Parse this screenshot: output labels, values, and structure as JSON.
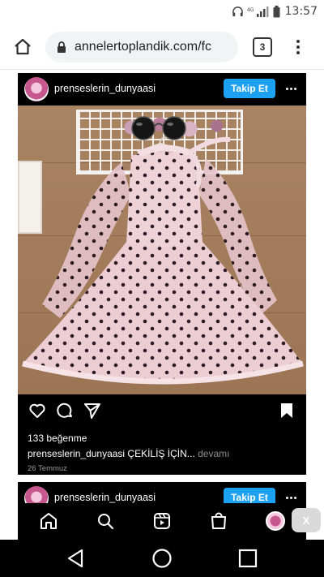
{
  "status_bar": {
    "time": "13:57"
  },
  "browser": {
    "url": "annelertoplandik.com/fc",
    "tab_count": "3"
  },
  "post": {
    "username": "prenseslerin_dunyaasi",
    "follow_label": "Takip Et",
    "likes": "133 beğenme",
    "caption_user": "prenseslerin_dunyaasi",
    "caption_text": "ÇEKİLİŞ İÇİN...",
    "caption_more": "devamı",
    "date": "26 Temmuz"
  },
  "next_post": {
    "username": "prenseslerin_dunyaasi",
    "follow_label": "Takip Et"
  },
  "overlay": {
    "close_label": "X"
  },
  "icons": {
    "home": "home-icon",
    "lock": "lock-icon",
    "menu": "more-vert-icon",
    "like": "heart-icon",
    "comment": "comment-icon",
    "share": "send-icon",
    "save": "bookmark-icon",
    "search": "search-icon",
    "reels": "reels-icon",
    "shop": "shop-icon",
    "back": "back-triangle-icon",
    "home_sys": "home-circle-icon",
    "recents": "recents-square-icon"
  },
  "colors": {
    "follow_button": "#1da1f2",
    "post_background": "#000000",
    "address_bar": "#f1f3f4"
  }
}
